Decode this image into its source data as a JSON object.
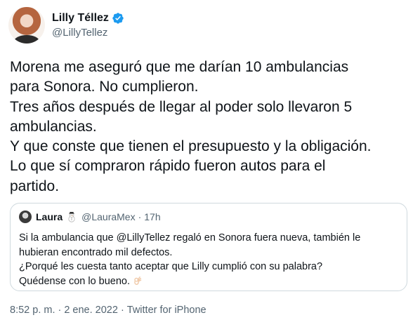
{
  "author": {
    "display_name": "Lilly Téllez",
    "handle": "@LillyTellez",
    "verified": true,
    "verified_icon": "verified-badge-icon",
    "accent_color": "#1d9bf0"
  },
  "tweet": {
    "lines": [
      "Morena me aseguró que me darían 10 ambulancias",
      "para Sonora. No cumplieron.",
      "Tres años después de llegar al poder solo llevaron 5",
      "ambulancias.",
      "Y que conste que tienen el presupuesto y la obligación.",
      "Lo que sí compraron rápido fueron autos para el",
      "partido."
    ]
  },
  "quoted_tweet": {
    "display_name": "Laura",
    "emoji_icon": "snowman-icon",
    "handle": "@LauraMex",
    "separator": "·",
    "time": "17h",
    "lines": [
      "Si la ambulancia que @LillyTellez regaló en Sonora fuera nueva, también le",
      "hubieran encontrado mil defectos.",
      "¿Porqué les cuesta tanto aceptar que Lilly cumplió con su palabra?",
      "Quédense con lo bueno."
    ],
    "trailing_icon": "ok-hand-icon"
  },
  "footer": {
    "time": "8:52 p. m.",
    "separator1": "·",
    "date": "2 ene. 2022",
    "separator2": "·",
    "source": "Twitter for iPhone"
  }
}
